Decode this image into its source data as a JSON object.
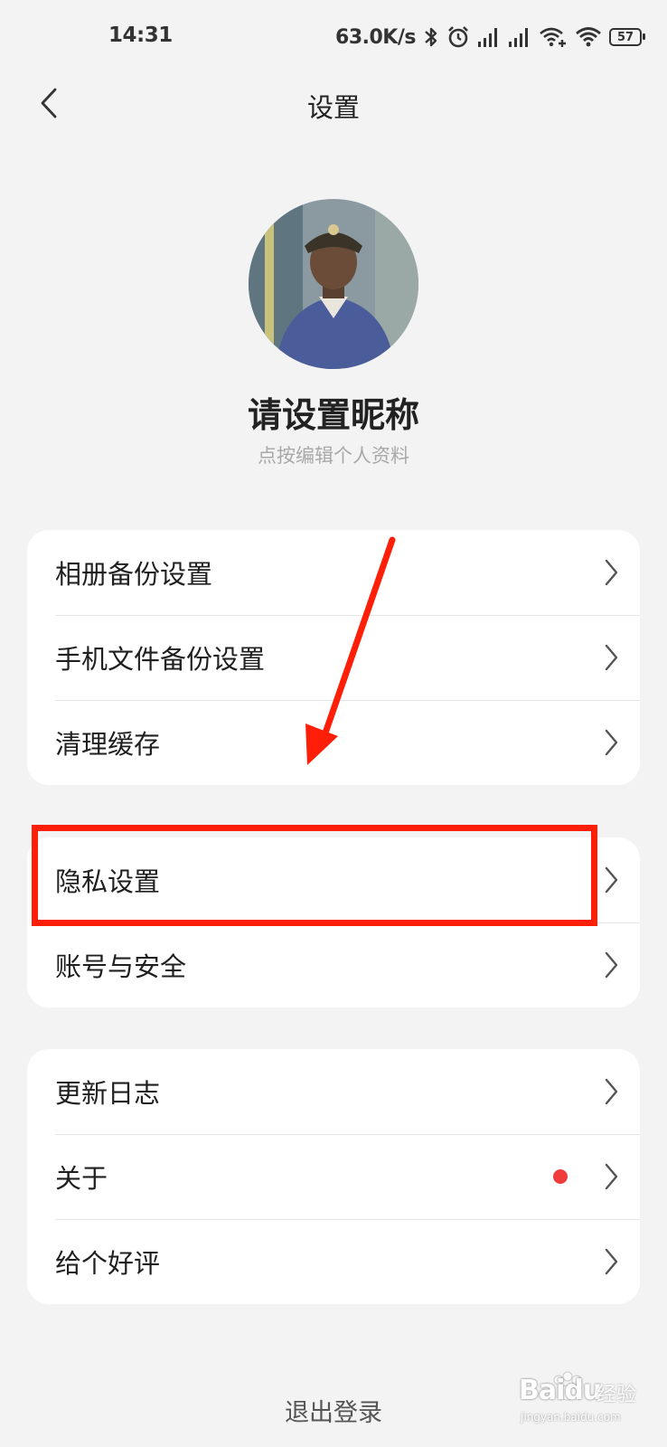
{
  "status_bar": {
    "time": "14:31",
    "net_speed": "63.0K/s",
    "battery": "57",
    "icons": [
      "bluetooth-icon",
      "alarm-icon",
      "signal-icon",
      "signal-icon",
      "wifi-plus-icon",
      "wifi-icon",
      "battery-icon"
    ]
  },
  "nav": {
    "title": "设置",
    "back_icon": "chevron-left-icon"
  },
  "profile": {
    "nickname": "请设置昵称",
    "hint": "点按编辑个人资料"
  },
  "groups": [
    {
      "items": [
        {
          "label": "相册备份设置"
        },
        {
          "label": "手机文件备份设置"
        },
        {
          "label": "清理缓存"
        }
      ]
    },
    {
      "items": [
        {
          "label": "隐私设置"
        },
        {
          "label": "账号与安全"
        }
      ]
    },
    {
      "items": [
        {
          "label": "更新日志"
        },
        {
          "label": "关于",
          "badge": "red-dot"
        },
        {
          "label": "给个好评"
        }
      ]
    }
  ],
  "logout_label": "退出登录",
  "annotation": {
    "color": "#ff1f08",
    "target": "隐私设置"
  },
  "watermark": {
    "brand": "Baidu",
    "cn": "经验",
    "url": "jingyan.baidu.com"
  },
  "colors": {
    "background": "#f3f3f3",
    "card": "#ffffff",
    "badge": "#ef3b3b"
  }
}
